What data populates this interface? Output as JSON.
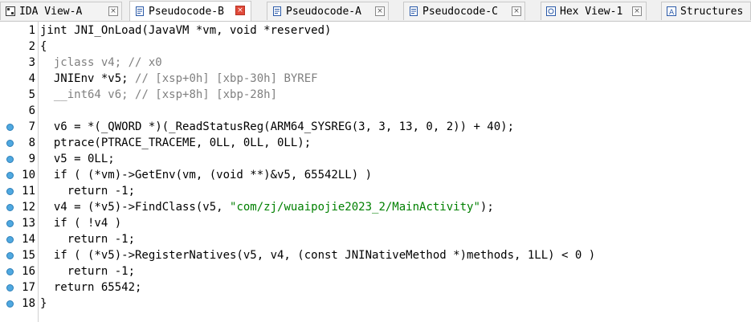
{
  "tabs": [
    {
      "label": "IDA View-A",
      "icon": "graph-view-icon",
      "active": false
    },
    {
      "label": "Pseudocode-B",
      "icon": "pseudocode-icon",
      "active": true
    },
    {
      "label": "Pseudocode-A",
      "icon": "pseudocode-icon",
      "active": false
    },
    {
      "label": "Pseudocode-C",
      "icon": "pseudocode-icon",
      "active": false
    },
    {
      "label": "Hex View-1",
      "icon": "hex-view-icon",
      "active": false
    },
    {
      "label": "Structures",
      "icon": "structures-icon",
      "active": false
    }
  ],
  "close_glyph": "×",
  "colors": {
    "breakpoint_dot": "#4fa8e0",
    "string": "#008000",
    "variable": "#000080",
    "comment": "#808080",
    "active_close": "#e04a3a"
  },
  "lines": [
    {
      "num": "1",
      "dot": false,
      "segments": [
        {
          "t": "jint JNI_OnLoad(JavaVM *vm, void *reserved)",
          "c": ""
        }
      ]
    },
    {
      "num": "2",
      "dot": false,
      "segments": [
        {
          "t": "{",
          "c": ""
        }
      ]
    },
    {
      "num": "3",
      "dot": false,
      "segments": [
        {
          "t": "  jclass v4; // x0",
          "c": "grey"
        }
      ]
    },
    {
      "num": "4",
      "dot": false,
      "segments": [
        {
          "t": "  JNIEnv *v5; ",
          "c": ""
        },
        {
          "t": "// [xsp+0h] [xbp-30h] BYREF",
          "c": "grey"
        }
      ]
    },
    {
      "num": "5",
      "dot": false,
      "segments": [
        {
          "t": "  __int64 v6; ",
          "c": "grey"
        },
        {
          "t": "// [xsp+8h] [xbp-28h]",
          "c": "grey"
        }
      ]
    },
    {
      "num": "6",
      "dot": false,
      "segments": [
        {
          "t": "",
          "c": ""
        }
      ]
    },
    {
      "num": "7",
      "dot": true,
      "segments": [
        {
          "t": "  v6 = *(_QWORD *)(_ReadStatusReg(ARM64_SYSREG(3, 3, 13, 0, 2)) + 40);",
          "c": ""
        }
      ]
    },
    {
      "num": "8",
      "dot": true,
      "segments": [
        {
          "t": "  ptrace(PTRACE_TRACEME, 0LL, 0LL, 0LL);",
          "c": ""
        }
      ]
    },
    {
      "num": "9",
      "dot": true,
      "segments": [
        {
          "t": "  v5 = 0LL;",
          "c": ""
        }
      ]
    },
    {
      "num": "10",
      "dot": true,
      "segments": [
        {
          "t": "  if ( (*vm)->GetEnv(vm, (void **)&v5, 65542LL) )",
          "c": ""
        }
      ]
    },
    {
      "num": "11",
      "dot": true,
      "segments": [
        {
          "t": "    return -1;",
          "c": ""
        }
      ]
    },
    {
      "num": "12",
      "dot": true,
      "segments": [
        {
          "t": "  v4 = (*v5)->FindClass(v5, ",
          "c": ""
        },
        {
          "t": "\"com/zj/wuaipojie2023_2/MainActivity\"",
          "c": "str"
        },
        {
          "t": ");",
          "c": ""
        }
      ]
    },
    {
      "num": "13",
      "dot": true,
      "segments": [
        {
          "t": "  if ( !v4 )",
          "c": ""
        }
      ]
    },
    {
      "num": "14",
      "dot": true,
      "segments": [
        {
          "t": "    return -1;",
          "c": ""
        }
      ]
    },
    {
      "num": "15",
      "dot": true,
      "segments": [
        {
          "t": "  if ( (*v5)->RegisterNatives(v5, v4, (const JNINativeMethod *)methods, 1LL) < 0 )",
          "c": ""
        }
      ]
    },
    {
      "num": "16",
      "dot": true,
      "segments": [
        {
          "t": "    return -1;",
          "c": ""
        }
      ]
    },
    {
      "num": "17",
      "dot": true,
      "segments": [
        {
          "t": "  return 65542;",
          "c": ""
        }
      ]
    },
    {
      "num": "18",
      "dot": true,
      "segments": [
        {
          "t": "}",
          "c": ""
        }
      ]
    }
  ]
}
